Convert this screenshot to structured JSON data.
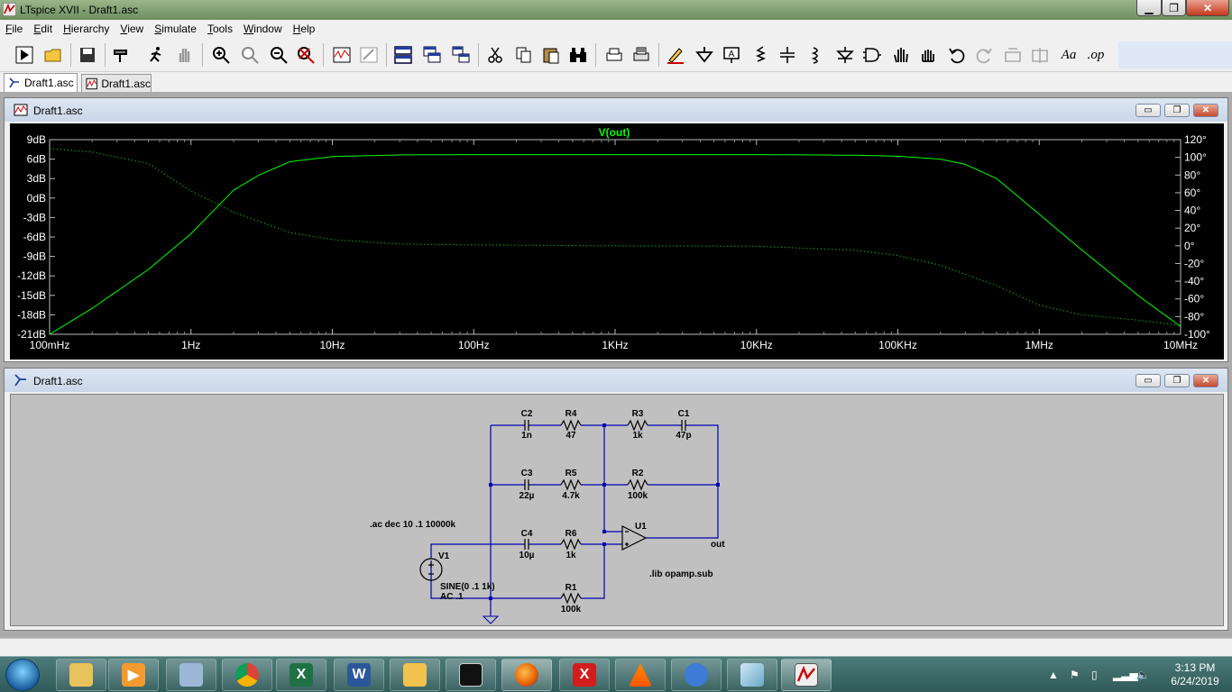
{
  "window": {
    "title": "LTspice XVII - Draft1.asc",
    "minimize": "▁",
    "maximize": "❐",
    "close": "✕"
  },
  "menu": [
    "File",
    "Edit",
    "Hierarchy",
    "View",
    "Simulate",
    "Tools",
    "Window",
    "Help"
  ],
  "toolbar": {
    "text_label": "Aa",
    "op_label": ".op"
  },
  "tabs": [
    {
      "label": "Draft1.asc",
      "icon": "schematic-icon",
      "active": true
    },
    {
      "label": "Draft1.asc",
      "icon": "waveform-icon",
      "active": false
    }
  ],
  "plot_window": {
    "title": "Draft1.asc",
    "trace_label": "V(out)",
    "trace_color": "#00ff00",
    "min": "▭",
    "max": "❐",
    "close": "✕"
  },
  "chart_data": {
    "type": "line",
    "x_scale": "log",
    "x_ticks": [
      "100mHz",
      "1Hz",
      "10Hz",
      "100Hz",
      "1KHz",
      "10KHz",
      "100KHz",
      "1MHz",
      "10MHz"
    ],
    "x_values_hz": [
      0.1,
      1,
      10,
      100,
      1000,
      10000,
      100000,
      1000000,
      10000000
    ],
    "y_left_ticks": [
      "9dB",
      "6dB",
      "3dB",
      "0dB",
      "-3dB",
      "-6dB",
      "-9dB",
      "-12dB",
      "-15dB",
      "-18dB",
      "-21dB"
    ],
    "ylim_left": [
      -21,
      9
    ],
    "y_right_ticks": [
      "120°",
      "100°",
      "80°",
      "60°",
      "40°",
      "20°",
      "0°",
      "-20°",
      "-40°",
      "-60°",
      "-80°",
      "-100°"
    ],
    "ylim_right": [
      -100,
      120
    ],
    "grid": false,
    "series": [
      {
        "name": "V(out)",
        "style": "solid",
        "axis": "left",
        "x": [
          0.1,
          0.2,
          0.5,
          1,
          2,
          3,
          5,
          10,
          30,
          100,
          1000,
          10000,
          50000,
          100000,
          200000,
          300000,
          500000,
          1000000,
          2000000,
          5000000,
          10000000
        ],
        "y": [
          -21,
          -17,
          -11,
          -5.5,
          1.2,
          3.5,
          5.6,
          6.4,
          6.65,
          6.7,
          6.7,
          6.7,
          6.6,
          6.45,
          6.0,
          5.2,
          3.0,
          -2.5,
          -8,
          -15,
          -19.8
        ]
      },
      {
        "name": "V(out)",
        "style": "dotted",
        "axis": "right",
        "x": [
          0.1,
          0.2,
          0.5,
          1,
          2,
          5,
          10,
          30,
          100,
          1000,
          10000,
          50000,
          100000,
          200000,
          500000,
          1000000,
          2000000,
          5000000,
          10000000
        ],
        "y": [
          110,
          106,
          93,
          62,
          38,
          15,
          7,
          2,
          1,
          0,
          -0.5,
          -5,
          -11,
          -22,
          -45,
          -67,
          -78,
          -84,
          -90
        ]
      }
    ]
  },
  "schematic_window": {
    "title": "Draft1.asc",
    "min": "▭",
    "max": "❐",
    "close": "✕",
    "labels": {
      "c2": "C2",
      "c2v": "1n",
      "r4": "R4",
      "r4v": "47",
      "r3": "R3",
      "r3v": "1k",
      "c1": "C1",
      "c1v": "47p",
      "c3": "C3",
      "c3v": "22µ",
      "r5": "R5",
      "r5v": "4.7k",
      "r2": "R2",
      "r2v": "100k",
      "c4": "C4",
      "c4v": "10µ",
      "r6": "R6",
      "r6v": "1k",
      "r1": "R1",
      "r1v": "100k",
      "u1": "U1",
      "out": "out",
      "v1": "V1",
      "v1_sine": "SINE(0 .1 1k)",
      "v1_ac": "AC .1",
      "ac_directive": ".ac dec 10 .1 10000k",
      "lib_directive": ".lib opamp.sub"
    }
  },
  "taskbar": {
    "clock_time": "3:13 PM",
    "clock_date": "6/24/2019"
  }
}
